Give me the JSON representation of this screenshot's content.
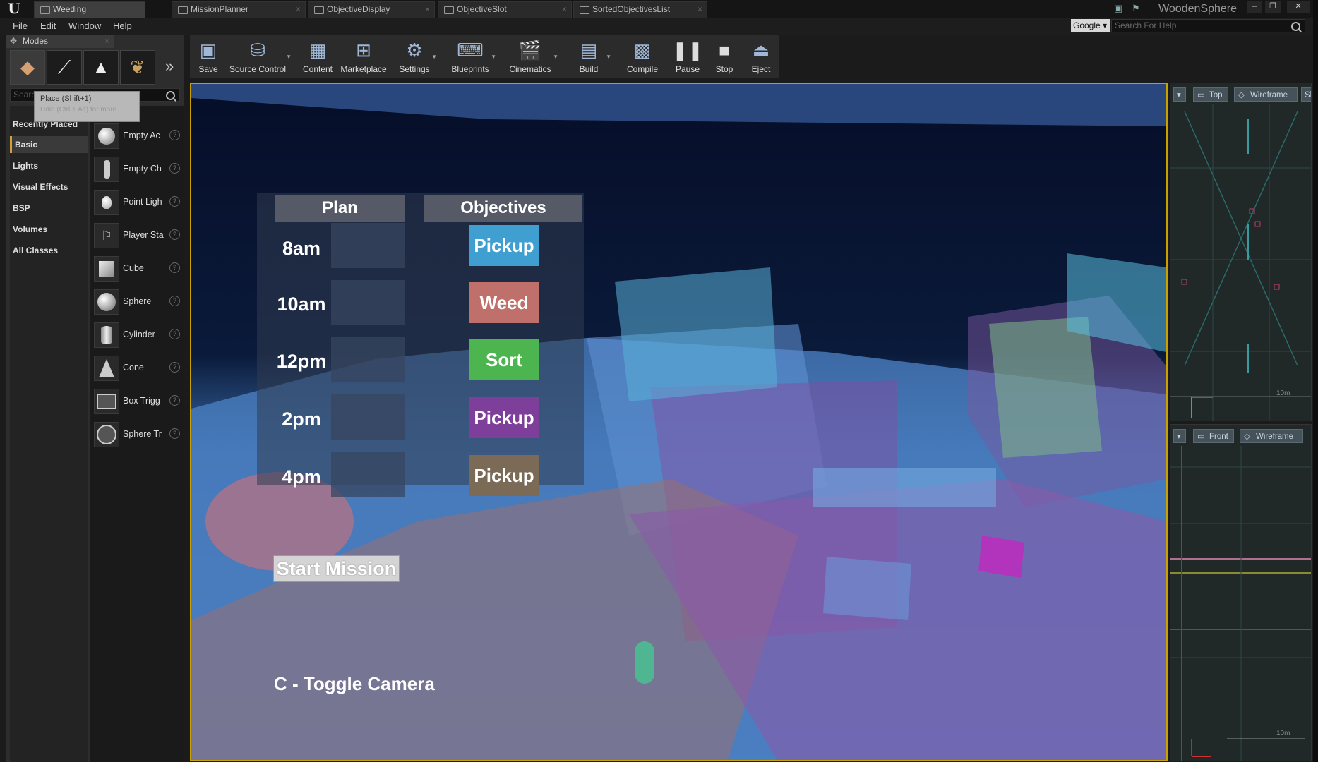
{
  "titlebar": {
    "tabs": [
      "Weeding",
      "MissionPlanner",
      "ObjectiveDisplay",
      "ObjectiveSlot",
      "SortedObjectivesList"
    ],
    "project_name": "WoodenSphere"
  },
  "menubar": {
    "items": [
      "File",
      "Edit",
      "Window",
      "Help"
    ],
    "search_engine": "Google",
    "search_placeholder": "Search For Help"
  },
  "modes": {
    "tab_label": "Modes",
    "search_placeholder": "Search Classes",
    "tooltip_title": "Place (Shift+1)",
    "tooltip_hint": "Hold (Ctrl + Alt) for more",
    "categories": [
      "Recently Placed",
      "Basic",
      "Lights",
      "Visual Effects",
      "BSP",
      "Volumes",
      "All Classes"
    ],
    "selected_category": "Basic",
    "items": [
      "Empty Ac",
      "Empty Ch",
      "Point Ligh",
      "Player Sta",
      "Cube",
      "Sphere",
      "Cylinder",
      "Cone",
      "Box Trigg",
      "Sphere Tr"
    ]
  },
  "toolbar": {
    "buttons": [
      "Save",
      "Source Control",
      "Content",
      "Marketplace",
      "Settings",
      "Blueprints",
      "Cinematics",
      "Build",
      "Compile",
      "Pause",
      "Stop",
      "Eject"
    ]
  },
  "hud": {
    "plan_header": "Plan",
    "objectives_header": "Objectives",
    "times": [
      "8am",
      "10am",
      "12pm",
      "2pm",
      "4pm"
    ],
    "objectives": [
      {
        "label": "Pickup",
        "color": "#3f9fd1"
      },
      {
        "label": "Weed",
        "color": "#c0706a"
      },
      {
        "label": "Sort",
        "color": "#4cb54f"
      },
      {
        "label": "Pickup",
        "color": "#7d3f9a"
      },
      {
        "label": "Pickup",
        "color": "#7a6a56"
      }
    ],
    "start_button": "Start Mission",
    "hint": "C - Toggle Camera"
  },
  "side_viewports": {
    "top": {
      "view": "Top",
      "mode": "Wireframe",
      "extra": "Sh",
      "scale": "10m"
    },
    "front": {
      "view": "Front",
      "mode": "Wireframe",
      "scale": "10m"
    }
  }
}
